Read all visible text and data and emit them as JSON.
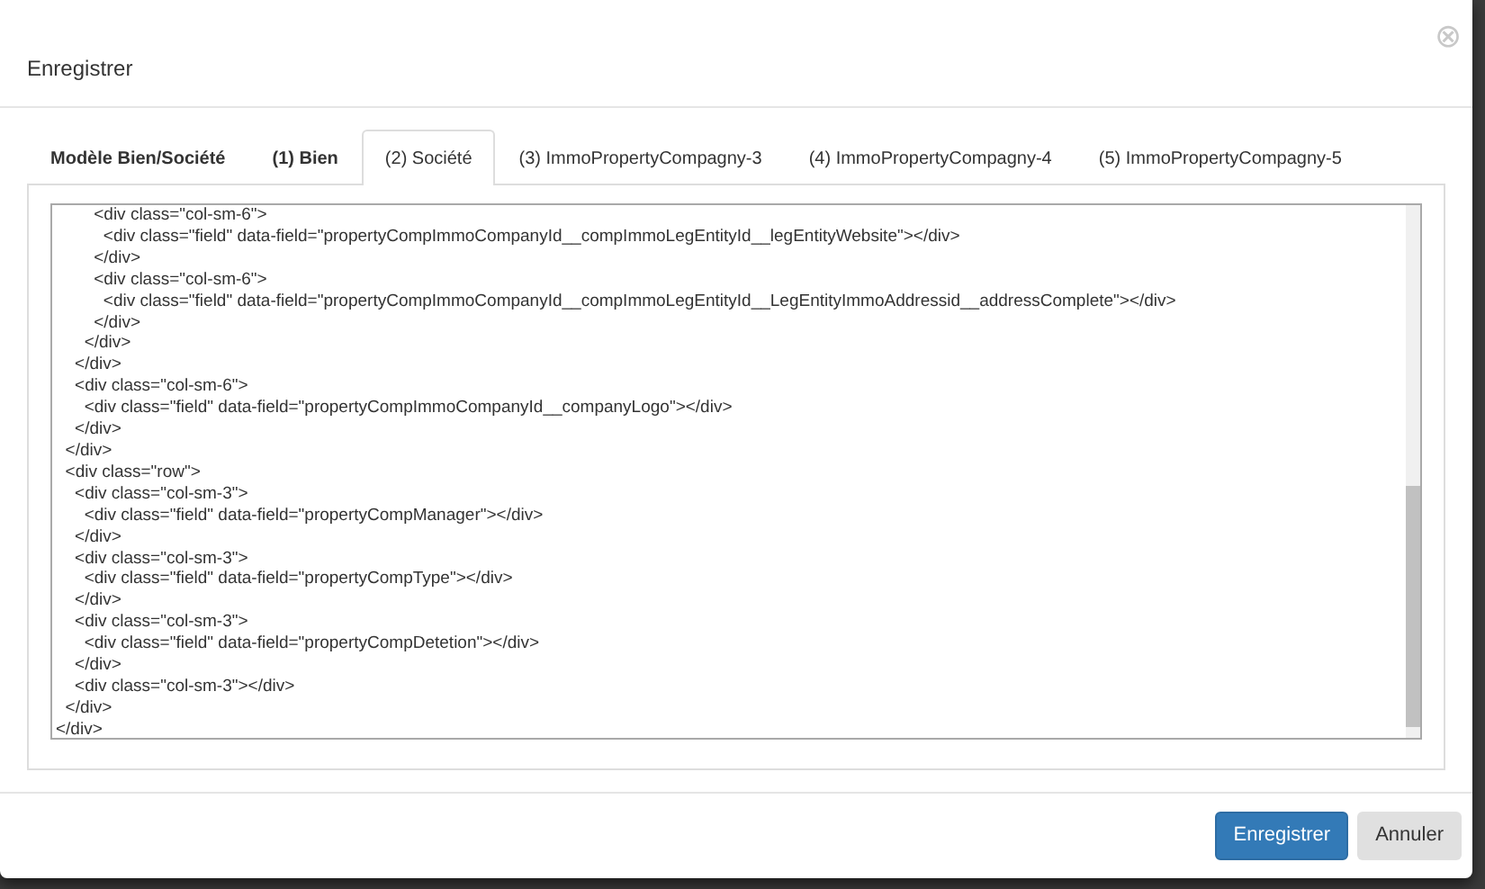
{
  "dialog": {
    "title": "Enregistrer",
    "close_label": "⊗"
  },
  "tabs": [
    {
      "label": "Modèle Bien/Société",
      "selected": false,
      "bold": true
    },
    {
      "label": "(1) Bien",
      "selected": false,
      "bold": true
    },
    {
      "label": "(2) Société",
      "selected": true,
      "bold": false
    },
    {
      "label": "(3) ImmoPropertyCompagny-3",
      "selected": false,
      "bold": false
    },
    {
      "label": "(4) ImmoPropertyCompagny-4",
      "selected": false,
      "bold": false
    },
    {
      "label": "(5) ImmoPropertyCompagny-5",
      "selected": false,
      "bold": false
    }
  ],
  "editor": {
    "lines": [
      "        <div class=\"col-sm-6\">",
      "          <div class=\"field\" data-field=\"propertyCompImmoCompanyId__compImmoLegEntityId__legEntityWebsite\"></div>",
      "        </div>",
      "        <div class=\"col-sm-6\">",
      "          <div class=\"field\" data-field=\"propertyCompImmoCompanyId__compImmoLegEntityId__LegEntityImmoAddressid__addressComplete\"></div>",
      "        </div>",
      "      </div>",
      "    </div>",
      "    <div class=\"col-sm-6\">",
      "      <div class=\"field\" data-field=\"propertyCompImmoCompanyId__companyLogo\"></div>",
      "    </div>",
      "  </div>",
      "  <div class=\"row\">",
      "    <div class=\"col-sm-3\">",
      "      <div class=\"field\" data-field=\"propertyCompManager\"></div>",
      "    </div>",
      "    <div class=\"col-sm-3\">",
      "      <div class=\"field\" data-field=\"propertyCompType\"></div>",
      "    </div>",
      "    <div class=\"col-sm-3\">",
      "      <div class=\"field\" data-field=\"propertyCompDetetion\"></div>",
      "    </div>",
      "    <div class=\"col-sm-3\"></div>",
      "  </div>",
      "</div>"
    ]
  },
  "buttons": [
    {
      "label": "Enregistrer",
      "kind": "primary"
    },
    {
      "label": "Annuler",
      "kind": "secondary"
    }
  ]
}
